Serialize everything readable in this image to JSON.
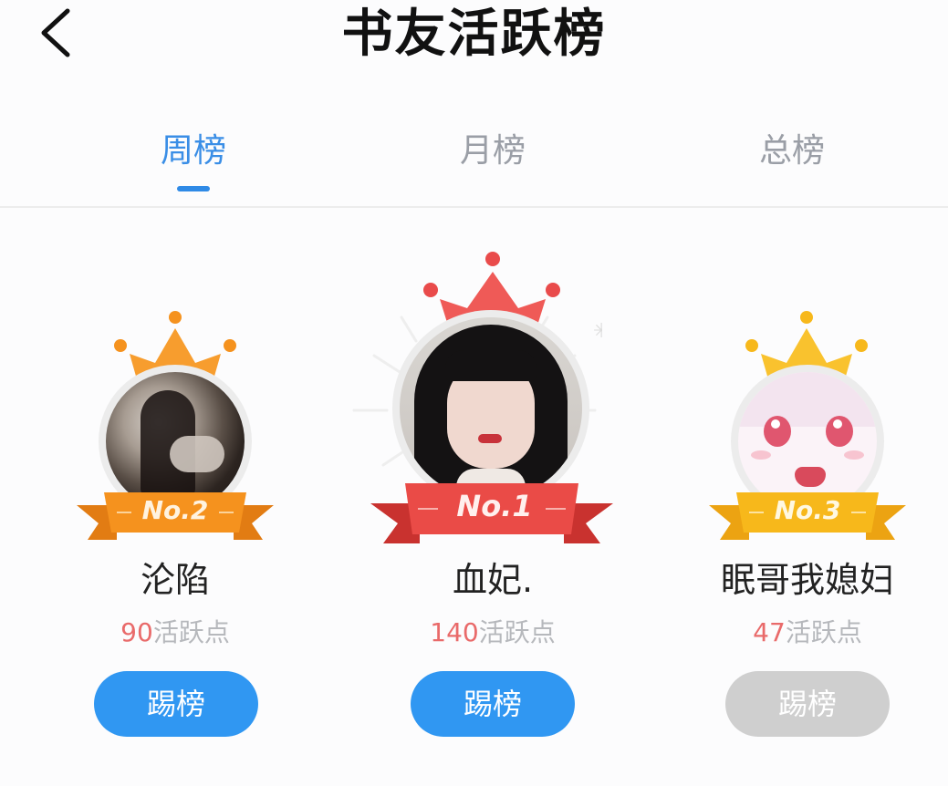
{
  "header": {
    "title": "书友活跃榜",
    "back_icon": "chevron-left-icon"
  },
  "tabs": [
    {
      "label": "周榜",
      "active": true
    },
    {
      "label": "月榜",
      "active": false
    },
    {
      "label": "总榜",
      "active": false
    }
  ],
  "colors": {
    "accent_blue": "#3097f2",
    "gold_rank1": "#e94b4b",
    "orange_rank2": "#f5921e",
    "yellow_rank3": "#f7b81b",
    "points_red": "#e96a6a",
    "disabled_gray": "#cfcfcf"
  },
  "ranking": [
    {
      "rank_label": "No.1",
      "name": "血妃.",
      "points": "140",
      "points_unit": "活跃点",
      "button": "踢榜",
      "button_enabled": true
    },
    {
      "rank_label": "No.2",
      "name": "沦陷",
      "points": "90",
      "points_unit": "活跃点",
      "button": "踢榜",
      "button_enabled": true
    },
    {
      "rank_label": "No.3",
      "name": "眠哥我媳妇",
      "points": "47",
      "points_unit": "活跃点",
      "button": "踢榜",
      "button_enabled": false
    }
  ]
}
